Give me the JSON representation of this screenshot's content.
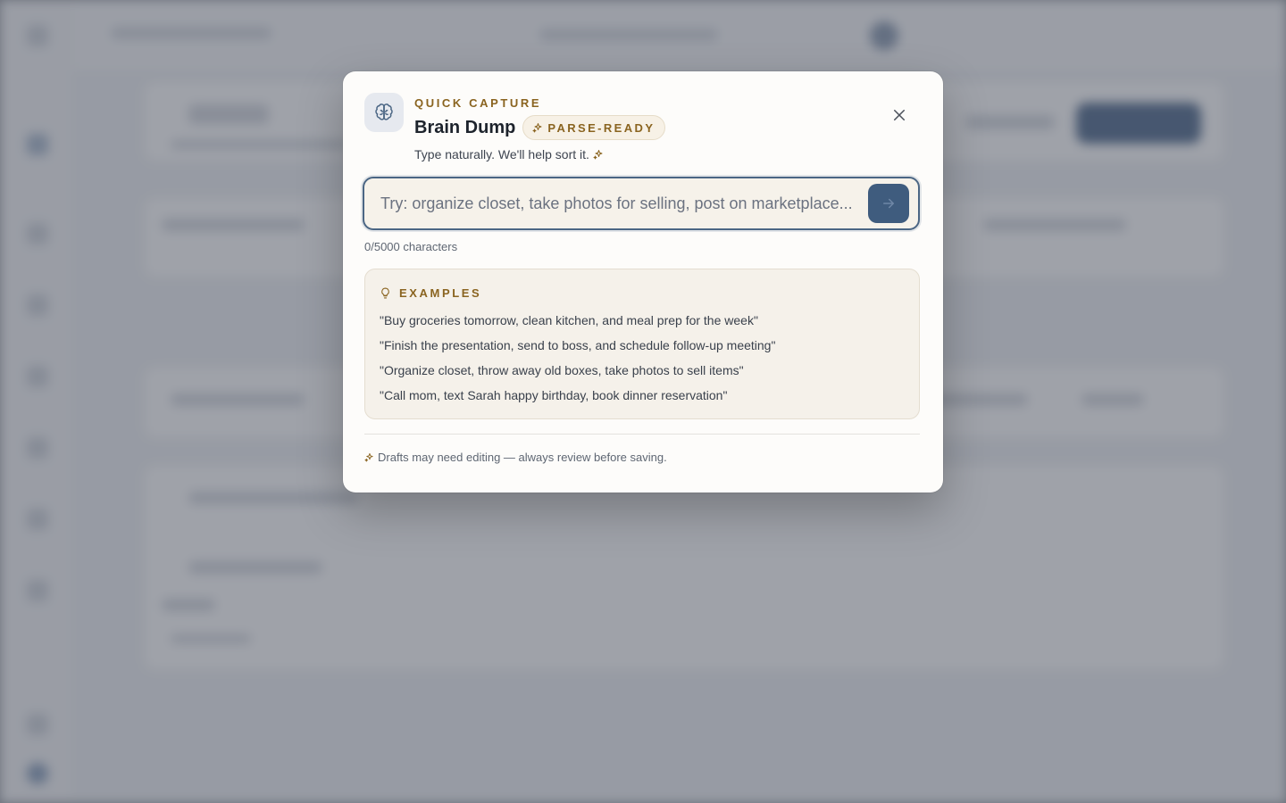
{
  "modal": {
    "eyebrow": "QUICK CAPTURE",
    "title": "Brain Dump",
    "badge": "PARSE-READY",
    "subtitle": "Type naturally. We'll help sort it.",
    "input": {
      "value": "",
      "placeholder": "Try: organize closet, take photos for selling, post on marketplace..."
    },
    "char_count": "0/5000 characters",
    "examples": {
      "heading": "EXAMPLES",
      "items": [
        "\"Buy groceries tomorrow, clean kitchen, and meal prep for the week\"",
        "\"Finish the presentation, send to boss, and schedule follow-up meeting\"",
        "\"Organize closet, throw away old boxes, take photos to sell items\"",
        "\"Call mom, text Sarah happy birthday, book dinner reservation\""
      ]
    },
    "footer_note": "Drafts may need editing — always review before saving."
  },
  "colors": {
    "accent": "#8a6420",
    "primary": "#3f5c7e",
    "surface": "#fdfcfa",
    "panel": "#f5f1ea"
  },
  "icons": {
    "app": "brain-icon",
    "close": "close-icon",
    "submit": "arrow-right-icon",
    "sparkle": "sparkle-icon",
    "examples": "lightbulb-icon"
  }
}
